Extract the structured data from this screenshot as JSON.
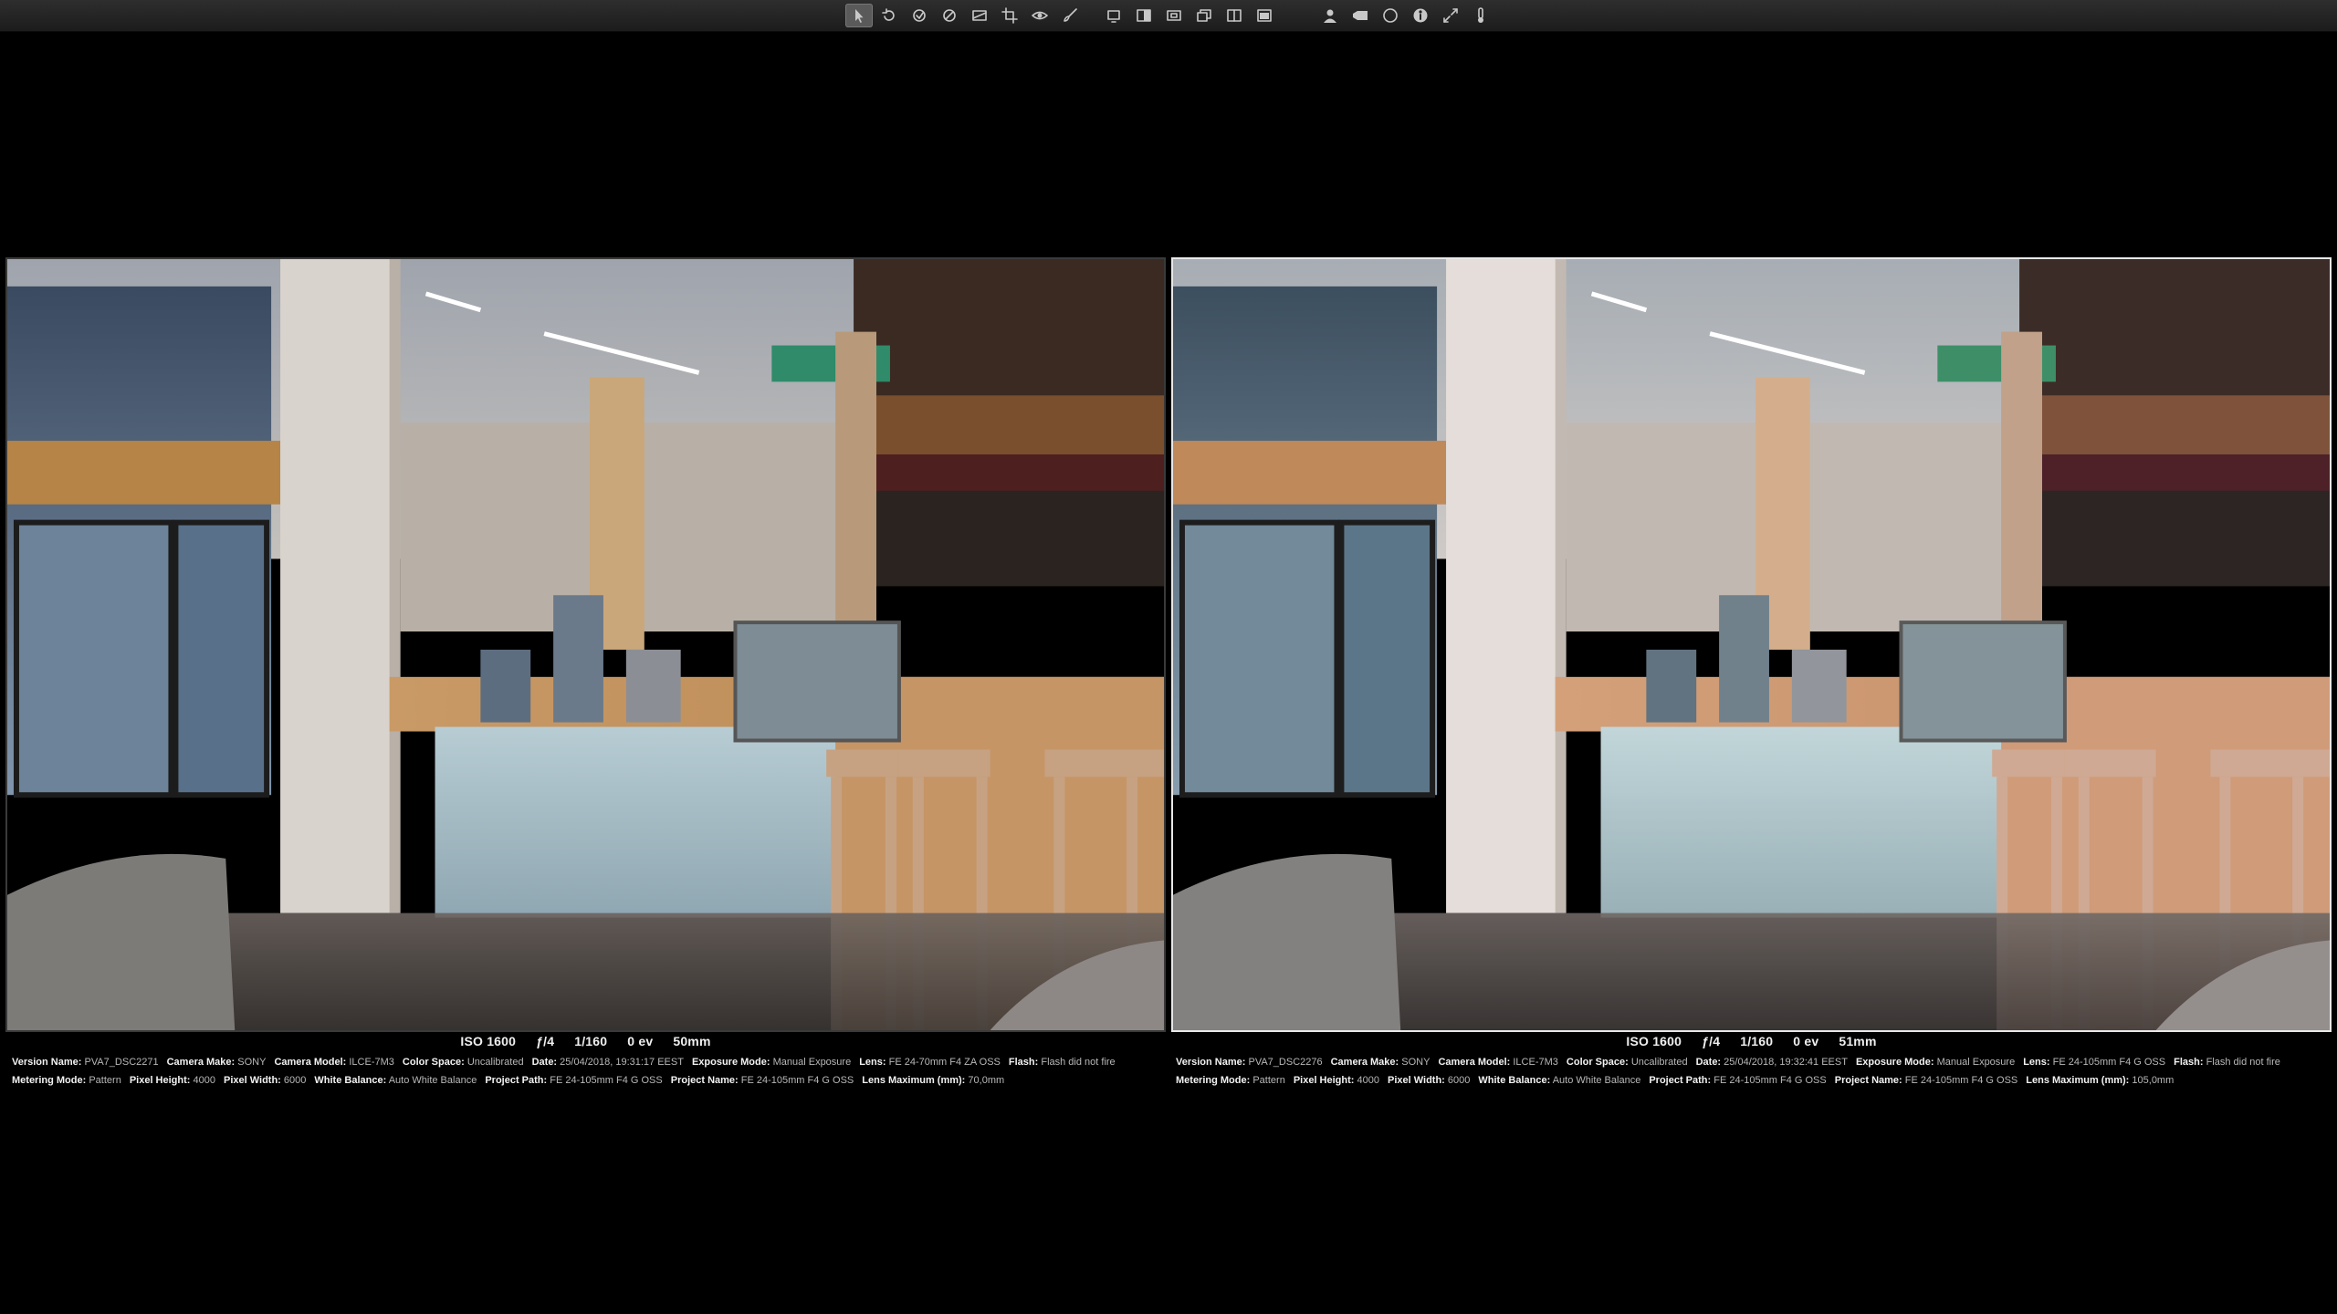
{
  "toolbar": {
    "groups": [
      [
        "pointer-icon",
        "rotate-icon",
        "lift-stamp-icon",
        "lift-adjust-icon",
        "straighten-icon",
        "crop-icon",
        "redeye-icon",
        "brush-icon"
      ],
      [
        "viewer-single-icon",
        "viewer-compare-icon",
        "viewer-multi-icon",
        "viewer-stack-icon",
        "viewer-split-icon",
        "viewer-full-icon"
      ],
      [
        "person-icon",
        "tag-icon",
        "loupe-icon",
        "info-icon",
        "expand-icon",
        "thermometer-icon"
      ]
    ]
  },
  "left": {
    "exif": {
      "iso": "ISO 1600",
      "aperture": "ƒ/4",
      "shutter": "1/160",
      "ev": "0 ev",
      "focal": "50mm"
    },
    "meta_row1": [
      {
        "k": "Version Name:",
        "v": "PVA7_DSC2271"
      },
      {
        "k": "Camera Make:",
        "v": "SONY"
      },
      {
        "k": "Camera Model:",
        "v": "ILCE-7M3"
      },
      {
        "k": "Color Space:",
        "v": "Uncalibrated"
      },
      {
        "k": "Date:",
        "v": "25/04/2018, 19:31:17 EEST"
      },
      {
        "k": "Exposure Mode:",
        "v": "Manual Exposure"
      },
      {
        "k": "Lens:",
        "v": "FE 24-70mm F4 ZA OSS"
      },
      {
        "k": "Flash:",
        "v": "Flash did not fire"
      }
    ],
    "meta_row2": [
      {
        "k": "Metering Mode:",
        "v": "Pattern"
      },
      {
        "k": "Pixel Height:",
        "v": "4000"
      },
      {
        "k": "Pixel Width:",
        "v": "6000"
      },
      {
        "k": "White Balance:",
        "v": "Auto White Balance"
      },
      {
        "k": "Project Path:",
        "v": "FE 24-105mm F4 G OSS"
      },
      {
        "k": "Project Name:",
        "v": "FE 24-105mm F4 G OSS"
      },
      {
        "k": "Lens Maximum (mm):",
        "v": "70,0mm"
      }
    ]
  },
  "right": {
    "exif": {
      "iso": "ISO 1600",
      "aperture": "ƒ/4",
      "shutter": "1/160",
      "ev": "0 ev",
      "focal": "51mm"
    },
    "meta_row1": [
      {
        "k": "Version Name:",
        "v": "PVA7_DSC2276"
      },
      {
        "k": "Camera Make:",
        "v": "SONY"
      },
      {
        "k": "Camera Model:",
        "v": "ILCE-7M3"
      },
      {
        "k": "Color Space:",
        "v": "Uncalibrated"
      },
      {
        "k": "Date:",
        "v": "25/04/2018, 19:32:41 EEST"
      },
      {
        "k": "Exposure Mode:",
        "v": "Manual Exposure"
      },
      {
        "k": "Lens:",
        "v": "FE 24-105mm F4 G OSS"
      },
      {
        "k": "Flash:",
        "v": "Flash did not fire"
      }
    ],
    "meta_row2": [
      {
        "k": "Metering Mode:",
        "v": "Pattern"
      },
      {
        "k": "Pixel Height:",
        "v": "4000"
      },
      {
        "k": "Pixel Width:",
        "v": "6000"
      },
      {
        "k": "White Balance:",
        "v": "Auto White Balance"
      },
      {
        "k": "Project Path:",
        "v": "FE 24-105mm F4 G OSS"
      },
      {
        "k": "Project Name:",
        "v": "FE 24-105mm F4 G OSS"
      },
      {
        "k": "Lens Maximum (mm):",
        "v": "105,0mm"
      }
    ]
  },
  "colors": {
    "background": "#000000",
    "toolbar": "#262626",
    "selected_border": "#e8e8e8",
    "text": "#f0f0f0"
  }
}
